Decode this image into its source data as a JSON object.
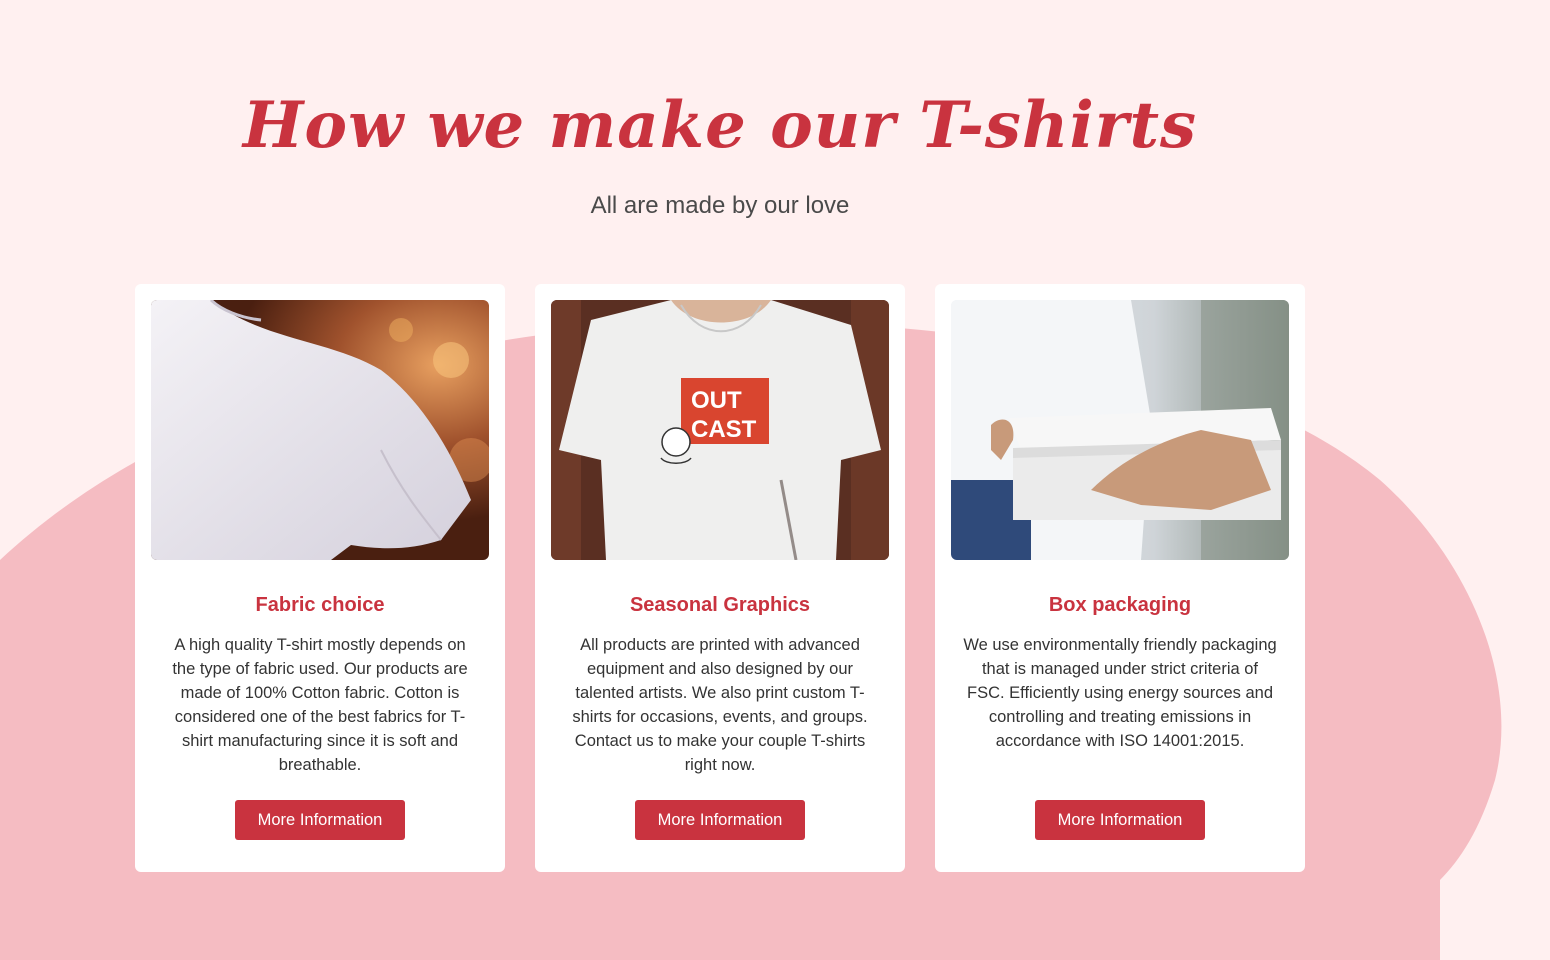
{
  "section": {
    "title": "How we make our T-shirts",
    "subtitle": "All are made by our love"
  },
  "cards": [
    {
      "image_alt": "woman shoulder white t-shirt photo",
      "title": "Fabric choice",
      "description": "A high quality T-shirt mostly depends on the type of fabric used. Our products are made of 100% Cotton fabric. Cotton is considered one of the best fabrics for T-shirt manufacturing since it is soft and breathable.",
      "button_label": "More Information"
    },
    {
      "image_alt": "man wearing printed t-shirt photo",
      "title": "Seasonal Graphics",
      "description": "All products are printed with advanced equipment and also designed by our talented artists. We also print custom T-shirts for occasions, events, and groups. Contact us to make your couple T-shirts right now.",
      "button_label": "More Information",
      "shirt_print": {
        "line1": "OUT",
        "line2": "CAST"
      }
    },
    {
      "image_alt": "box delivery handover photo",
      "title": "Box packaging",
      "description": "We use environmentally friendly packaging that is managed under strict criteria of FSC. Efficiently using energy sources and controlling and treating emissions in accordance with ISO 14001:2015.",
      "button_label": "More Information"
    }
  ],
  "colors": {
    "accent": "#c9333f",
    "page_background": "#fff0f0",
    "blob": "#f5bcc2",
    "card_background": "#ffffff"
  }
}
